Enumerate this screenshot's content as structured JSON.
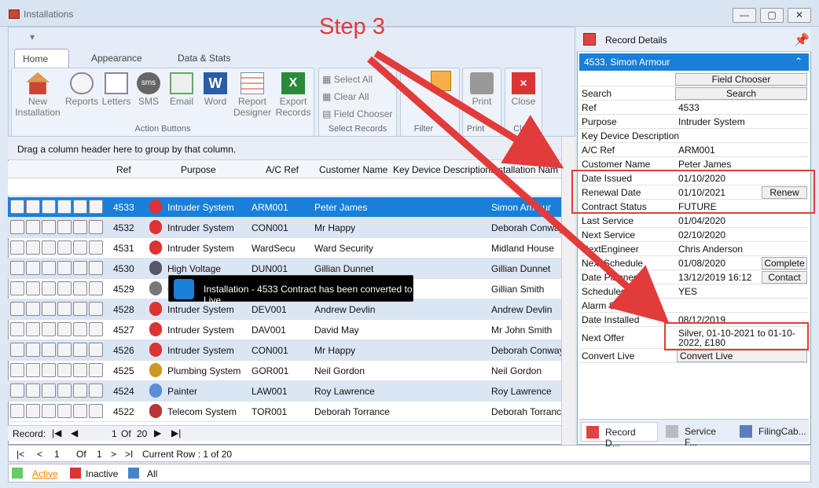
{
  "window": {
    "title": "Installations",
    "buttons": [
      "—",
      "▢",
      "✕"
    ]
  },
  "annotation": {
    "step": "Step 3"
  },
  "ribbon": {
    "tabs": [
      "Home",
      "Appearance",
      "Data & Stats"
    ],
    "buttons": [
      "New Installation",
      "Reports",
      "Letters",
      "SMS",
      "Email",
      "Word",
      "Report Designer",
      "Export Records"
    ],
    "action_group_label": "Action Buttons",
    "select": [
      "Select All",
      "Clear All",
      "Field Chooser"
    ],
    "select_group_label": "Select Records",
    "filter_label": "Filter",
    "print_label": "Print",
    "close_label": "Close",
    "print_group": "Print",
    "close_group": "Clo..."
  },
  "grid": {
    "group_hint": "Drag a column header here to group by that column.",
    "columns": [
      "Ref",
      "Purpose",
      "A/C Ref",
      "Customer Name",
      "Key Device Description",
      "Installation Nam"
    ],
    "rows": [
      {
        "ref": "4533",
        "purpose": "Intruder System",
        "ac": "ARM001",
        "customer": "Peter James",
        "key": "",
        "install": "Simon Armour"
      },
      {
        "ref": "4532",
        "purpose": "Intruder System",
        "ac": "CON001",
        "customer": "Mr Happy",
        "key": "",
        "install": "Deborah Conway"
      },
      {
        "ref": "4531",
        "purpose": "Intruder System",
        "ac": "WardSecu",
        "customer": "Ward Security",
        "key": "",
        "install": "Midland House"
      },
      {
        "ref": "4530",
        "purpose": "High Voltage",
        "ac": "DUN001",
        "customer": "Gillian Dunnet",
        "key": "",
        "install": "Gillian Dunnet"
      },
      {
        "ref": "4529",
        "purpose": "C",
        "ac": "",
        "customer": "",
        "key": "",
        "install": "Gillian Smith"
      },
      {
        "ref": "4528",
        "purpose": "Intruder System",
        "ac": "DEV001",
        "customer": "Andrew Devlin",
        "key": "",
        "install": "Andrew Devlin"
      },
      {
        "ref": "4527",
        "purpose": "Intruder System",
        "ac": "DAV001",
        "customer": "David May",
        "key": "",
        "install": "Mr John Smith"
      },
      {
        "ref": "4526",
        "purpose": "Intruder System",
        "ac": "CON001",
        "customer": "Mr Happy",
        "key": "",
        "install": "Deborah Conway"
      },
      {
        "ref": "4525",
        "purpose": "Plumbing System",
        "ac": "GOR001",
        "customer": "Neil Gordon",
        "key": "",
        "install": "Neil Gordon"
      },
      {
        "ref": "4524",
        "purpose": "Painter",
        "ac": "LAW001",
        "customer": "Roy Lawrence",
        "key": "",
        "install": "Roy Lawrence"
      },
      {
        "ref": "4522",
        "purpose": "Telecom System",
        "ac": "TOR001",
        "customer": "Deborah Torrance",
        "key": "",
        "install": "Deborah Torrance"
      }
    ],
    "record_label": "Record:",
    "record_current": "1",
    "record_of": "Of",
    "record_total": "20"
  },
  "toast": "Installation - 4533 Contract has been converted to Live",
  "pager": {
    "first": "|<",
    "prev": "<",
    "page": "1",
    "of": "Of",
    "total": "1",
    "next": ">",
    "last": ">I",
    "current": "Current Row : 1 of 20"
  },
  "bottom_tabs": [
    "Active",
    "Inactive",
    "All"
  ],
  "details": {
    "title": "Record Details",
    "header": "4533. Simon Armour",
    "field_chooser": "Field Chooser",
    "rows": [
      {
        "label": "Search",
        "value": "",
        "button": "Search"
      },
      {
        "label": "Ref",
        "value": "4533",
        "button": ""
      },
      {
        "label": "Purpose",
        "value": "Intruder System",
        "button": ""
      },
      {
        "label": "Key Device Description",
        "value": "",
        "button": ""
      },
      {
        "label": "A/C Ref",
        "value": "ARM001",
        "button": ""
      },
      {
        "label": "Customer Name",
        "value": "Peter James",
        "button": ""
      },
      {
        "label": "Date Issued",
        "value": "01/10/2020",
        "button": ""
      },
      {
        "label": "Renewal Date",
        "value": "01/10/2021",
        "button": "Renew"
      },
      {
        "label": "Contract Status",
        "value": "FUTURE",
        "button": ""
      },
      {
        "label": "Last Service",
        "value": "01/04/2020",
        "button": ""
      },
      {
        "label": "Next Service",
        "value": "02/10/2020",
        "button": ""
      },
      {
        "label": "NextEngineer",
        "value": "Chris Anderson",
        "button": ""
      },
      {
        "label": "Next Schedule",
        "value": "01/08/2020",
        "button": "Complete"
      },
      {
        "label": "Date Planned",
        "value": "13/12/2019 16:12",
        "button": "Contact"
      },
      {
        "label": "Scheduled",
        "value": "YES",
        "button": ""
      },
      {
        "label": "Alarm Status",
        "value": "",
        "button": ""
      },
      {
        "label": "Date Installed",
        "value": "08/12/2019",
        "button": ""
      }
    ],
    "next_offer_label": "Next Offer",
    "next_offer_value": "Silver, 01-10-2021 to 01-10-2022, £180",
    "convert_label": "Convert Live",
    "convert_button": "Convert Live",
    "tabs": [
      "Record D...",
      "Service F...",
      "FilingCab..."
    ]
  }
}
